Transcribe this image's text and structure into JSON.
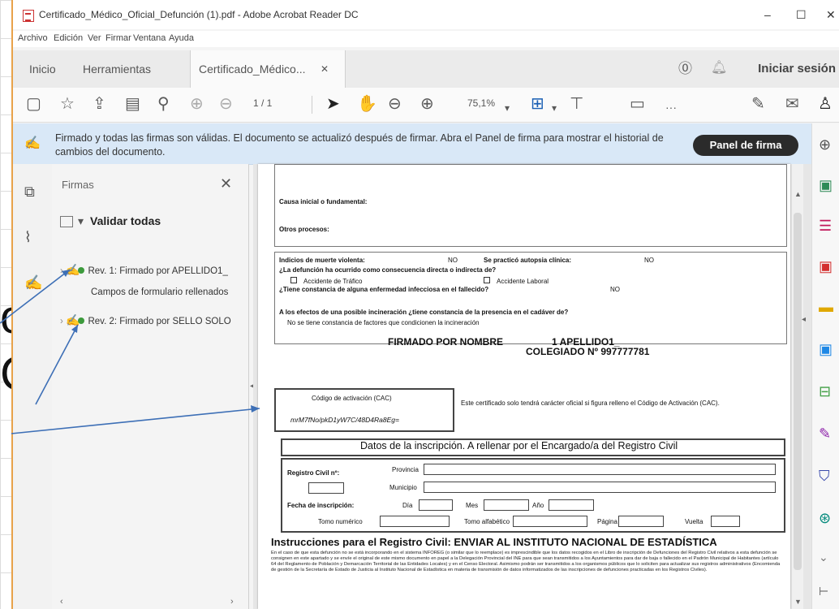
{
  "slide": {
    "fragments": [
      "o",
      "C"
    ]
  },
  "window": {
    "title": "Certificado_Médico_Oficial_Defunción (1).pdf - Adobe Acrobat Reader DC",
    "controls": {
      "minimize": "–",
      "maximize": "☐",
      "close": "✕"
    }
  },
  "menu": [
    "Archivo",
    "Edición",
    "Ver",
    "Firmar",
    "Ventana",
    "Ayuda"
  ],
  "tabs": {
    "home": "Inicio",
    "tools": "Herramientas",
    "doc": "Certificado_Médico...",
    "close": "✕",
    "login": "Iniciar sesión"
  },
  "toolbar": {
    "page": "1 / 1",
    "zoom": "75,1%"
  },
  "notice": {
    "text": "Firmado y todas las firmas son válidas. El documento se actualizó después de firmar. Abra el Panel de firma para mostrar el historial de cambios del documento.",
    "button": "Panel de firma"
  },
  "signatures": {
    "title": "Firmas",
    "close": "✕",
    "validate_all": "Validar todas",
    "rev1": "Rev. 1: Firmado por APELLIDO1_",
    "form_fields": "Campos de formulario rellenados",
    "rev2": "Rev. 2: Firmado por SELLO SOLO"
  },
  "document": {
    "cause_initial": "Causa inicial o fundamental:",
    "other_processes": "Otros procesos:",
    "violent_death": "Indicios de muerte violenta:",
    "violent_death_val": "NO",
    "autopsy": "Se practicó autopsia clínica:",
    "autopsy_val": "NO",
    "direct_question": "¿La defunción ha ocurrido como consecuencia directa o indirecta de?",
    "traffic": "Accidente de Tráfico",
    "work": "Accidente Laboral",
    "infectious": "¿Tiene constancia de alguna enfermedad infecciosa en el fallecido?",
    "infectious_val": "NO",
    "incineration_q": "A los efectos de una posible incineración ¿tiene constancia de la presencia en el cadáver de?",
    "incineration_a": "No se tiene constancia de factores que condicionen la incineración",
    "signed_by": "FIRMADO POR NOMBRE",
    "surname": "1 APELLIDO1_",
    "colegiado": "COLEGIADO Nº 997777781",
    "cac_label": "Código de activación (CAC)",
    "cac_value": "mrM7fNo/pkD1yW7C/48D4Ra8Eg=",
    "cac_note": "Este certificado solo tendrá carácter oficial si figura relleno el Código de Activación (CAC).",
    "inscription_title": "Datos de la inscripción. A rellenar por el Encargado/a del Registro Civil",
    "registry": "Registro Civil nº:",
    "province": "Provincia",
    "municipality": "Municipio",
    "inscription_date": "Fecha de inscripción:",
    "day": "Día",
    "month": "Mes",
    "year": "Año",
    "tomo_num": "Tomo numérico",
    "tomo_alpha": "Tomo alfabético",
    "page": "Página",
    "back": "Vuelta",
    "instructions_title": "Instrucciones para el Registro Civil: ENVIAR AL INSTITUTO NACIONAL DE ESTADÍSTICA",
    "instructions_text": "En el caso de que esta defunción no se está incorporando en el sistema INFOREG (o similar que lo reemplace) es imprescindible que los datos recogidos en el Libro de inscripción de Defunciones del Registro Civil relativos a esta defunción se consignen en este apartado y se envíe el original de este mismo documento en papel a la Delegación Provincial del INE para que sean transmitidos a los Ayuntamientos para dar de baja o fallecido en el Padrón Municipal de Habitantes (artículo 64 del Reglamento de Población y Demarcación Territorial de las Entidades Locales) y en el Censo Electoral. Asimismo podrán ser transmitidos a los organismos públicos que lo soliciten para actualizar sus registros administrativos (Encomienda de gestión de la Secretaría de Estado de Justicia al Instituto Nacional de Estadística en materia de transmisión de datos informatizados de las inscripciones de defunciones practicadas en los Registros Civiles)."
  },
  "colors": {
    "accent": "#1a5fb4",
    "notice_bg": "#d9e8f7",
    "valid": "#3c9a3c",
    "arrow": "#3d6fb6"
  }
}
